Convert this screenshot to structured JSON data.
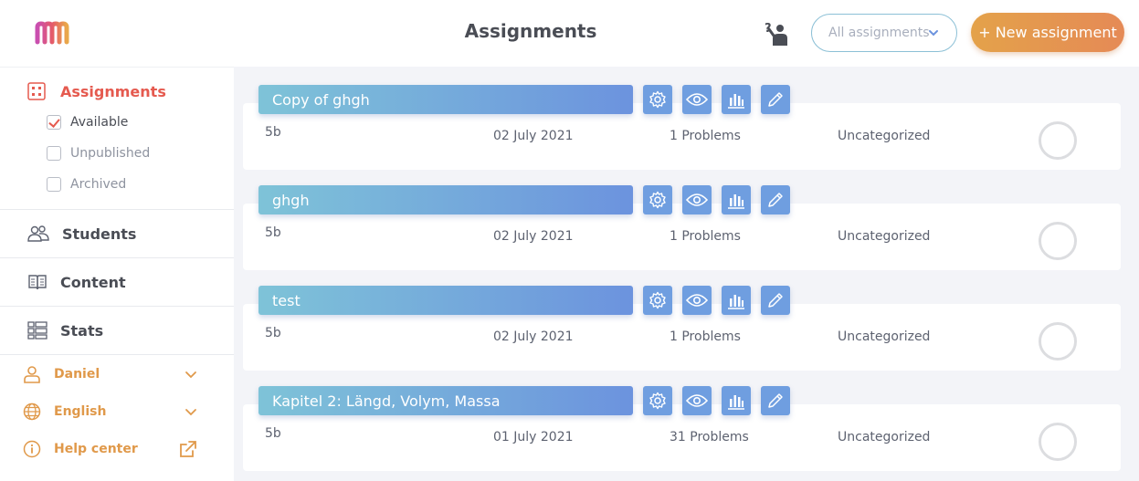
{
  "header": {
    "title": "Assignments",
    "filter": {
      "selected": "All assignments"
    },
    "new_button": "+ New assignment"
  },
  "sidebar": {
    "assignments": {
      "label": "Assignments",
      "filters": [
        {
          "label": "Available",
          "checked": true
        },
        {
          "label": "Unpublished",
          "checked": false
        },
        {
          "label": "Archived",
          "checked": false
        }
      ]
    },
    "students": "Students",
    "content": "Content",
    "stats": "Stats",
    "user": "Daniel",
    "language": "English",
    "help": "Help center"
  },
  "assignments": [
    {
      "title": "Copy of ghgh",
      "group": "5b",
      "date": "02 July 2021",
      "problems": "1 Problems",
      "category": "Uncategorized"
    },
    {
      "title": "ghgh",
      "group": "5b",
      "date": "02 July 2021",
      "problems": "1 Problems",
      "category": "Uncategorized"
    },
    {
      "title": "test",
      "group": "5b",
      "date": "02 July 2021",
      "problems": "1 Problems",
      "category": "Uncategorized"
    },
    {
      "title": "Kapitel 2: Längd, Volym, Massa",
      "group": "5b",
      "date": "01 July 2021",
      "problems": "31 Problems",
      "category": "Uncategorized"
    }
  ],
  "colors": {
    "accent_red": "#e55a4f",
    "accent_orange": "#e0994a",
    "action_blue": "#6f9ee0"
  }
}
